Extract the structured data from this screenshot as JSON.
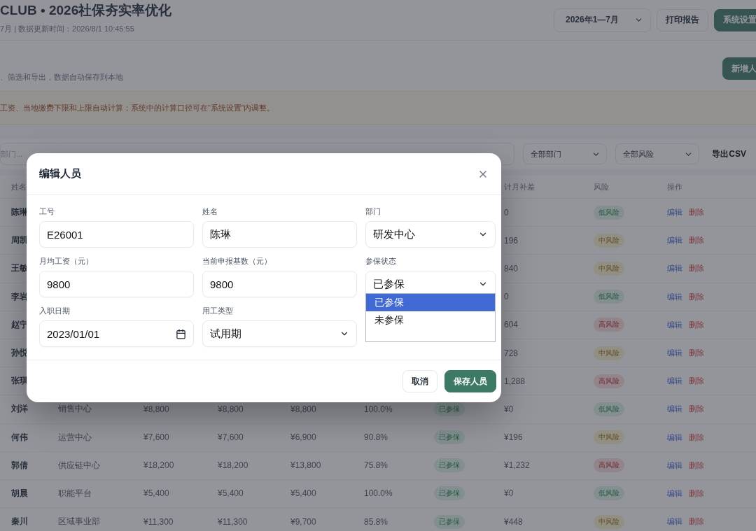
{
  "header": {
    "title": "CLUB • 2026社保夯实率优化",
    "subtitle": "7月 | 数据更新时间：2026/8/1 10:45:55",
    "period": "2026年1—7月",
    "buttons": [
      {
        "label": "打印报告",
        "kind": "plain"
      },
      {
        "label": "系统设置",
        "kind": "primary"
      }
    ]
  },
  "section": {
    "description": "、筛选和导出，数据自动保存到本地",
    "add_button": "新增人"
  },
  "notice": {
    "text": "工资、当地缴费下限和上限自动计算；系统中的计算口径可在“系统设置”内调整。"
  },
  "toolbar": {
    "search": {
      "placeholder": "部门..."
    },
    "filters": [
      "全部部门",
      "全部风险"
    ],
    "export": "导出CSV"
  },
  "table": {
    "columns": [
      {
        "kind": "name",
        "label": "姓名"
      },
      {
        "kind": "diff",
        "label": "计月补差"
      },
      {
        "kind": "risk",
        "label": "风险"
      },
      {
        "kind": "actions",
        "label": "操作"
      }
    ],
    "rows": [
      {
        "name": "陈琳",
        "diff": "0",
        "risk": {
          "label": "低风险",
          "kind": "low"
        },
        "actions": [
          "编辑",
          "删除"
        ]
      },
      {
        "name": "周凯",
        "diff": "196",
        "risk": {
          "label": "中风险",
          "kind": "mid"
        },
        "actions": [
          "编辑",
          "删除"
        ]
      },
      {
        "name": "王敏",
        "diff": "840",
        "risk": {
          "label": "中风险",
          "kind": "mid"
        },
        "actions": [
          "编辑",
          "删除"
        ]
      },
      {
        "name": "李岩",
        "diff": "0",
        "risk": {
          "label": "低风险",
          "kind": "low"
        },
        "actions": [
          "编辑",
          "删除"
        ]
      },
      {
        "name": "赵宁",
        "diff": "604",
        "risk": {
          "label": "高风险",
          "kind": "high"
        },
        "actions": [
          "编辑",
          "删除"
        ]
      },
      {
        "name": "孙悦",
        "diff": "728",
        "risk": {
          "label": "中风险",
          "kind": "mid"
        },
        "actions": [
          "编辑",
          "删除"
        ]
      },
      {
        "name": "张琪",
        "diff": "1,288",
        "risk": {
          "label": "高风险",
          "kind": "high"
        },
        "actions": [
          "编辑",
          "删除"
        ]
      },
      {
        "name": "刘洋",
        "dept": "销售中心",
        "salary": "¥8,800",
        "base": "¥8,800",
        "column_5": "¥8,800",
        "rate": "100.0%",
        "status": "已参保",
        "diff": "¥0",
        "risk": {
          "label": "低风险",
          "kind": "low"
        },
        "actions": [
          "编辑",
          "删除"
        ]
      },
      {
        "name": "何伟",
        "dept": "运营中心",
        "salary": "¥7,600",
        "base": "¥7,600",
        "column_5": "¥6,900",
        "rate": "90.8%",
        "status": "已参保",
        "diff": "¥196",
        "risk": {
          "label": "中风险",
          "kind": "mid"
        },
        "actions": [
          "编辑",
          "删除"
        ]
      },
      {
        "name": "郭倩",
        "dept": "供应链中心",
        "salary": "¥18,200",
        "base": "¥18,200",
        "column_5": "¥13,800",
        "rate": "75.8%",
        "status": "已参保",
        "diff": "¥1,232",
        "risk": {
          "label": "高风险",
          "kind": "high"
        },
        "actions": [
          "编辑",
          "删除"
        ]
      },
      {
        "name": "胡晨",
        "dept": "职能平台",
        "salary": "¥5,400",
        "base": "¥5,400",
        "column_5": "¥5,400",
        "rate": "100.0%",
        "status": "已参保",
        "diff": "¥0",
        "risk": {
          "label": "低风险",
          "kind": "low"
        },
        "actions": [
          "编辑",
          "删除"
        ]
      },
      {
        "name": "秦川",
        "dept": "区域事业部",
        "salary": "¥11,300",
        "base": "¥11,300",
        "column_5": "¥9,700",
        "rate": "85.8%",
        "status": "已参保",
        "diff": "¥448",
        "risk": {
          "label": "中风险",
          "kind": "mid"
        },
        "actions": [
          "编辑",
          "删除"
        ]
      }
    ]
  },
  "modal": {
    "title": "编辑人员",
    "fields": [
      {
        "label": "工号",
        "kind": "text",
        "value": "E26001"
      },
      {
        "label": "姓名",
        "kind": "text",
        "value": "陈琳"
      },
      {
        "label": "部门",
        "kind": "select",
        "value": "研发中心"
      },
      {
        "label": "月均工资（元）",
        "kind": "text",
        "value": "9800"
      },
      {
        "label": "当前申报基数（元）",
        "kind": "text",
        "value": "9800"
      },
      {
        "label": "参保状态",
        "kind": "select",
        "value": "已参保",
        "options": [
          {
            "label": "已参保",
            "selected": true
          },
          {
            "label": "未参保",
            "selected": false
          }
        ]
      },
      {
        "label": "入职日期",
        "kind": "date",
        "value": "2023/01/01"
      },
      {
        "label": "用工类型",
        "kind": "select",
        "value": "试用期"
      }
    ],
    "buttons": [
      {
        "label": "取消",
        "kind": "plain"
      },
      {
        "label": "保存人员",
        "kind": "primary"
      }
    ]
  }
}
